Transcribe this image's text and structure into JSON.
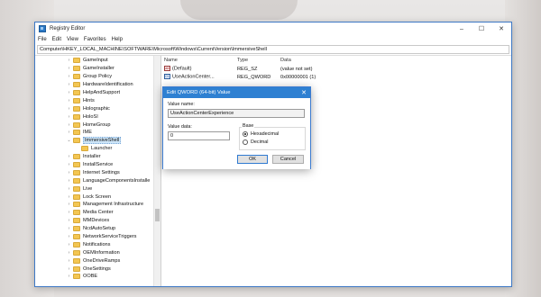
{
  "window": {
    "title": "Registry Editor",
    "controls": {
      "minimize": "–",
      "maximize": "☐",
      "close": "✕"
    }
  },
  "menu": [
    "File",
    "Edit",
    "View",
    "Favorites",
    "Help"
  ],
  "address": "Computer\\HKEY_LOCAL_MACHINE\\SOFTWARE\\Microsoft\\Windows\\CurrentVersion\\ImmersiveShell",
  "tree": [
    {
      "label": "GameInput",
      "expander": "›"
    },
    {
      "label": "GameInstaller",
      "expander": "›"
    },
    {
      "label": "Group Policy",
      "expander": "›"
    },
    {
      "label": "HardwareIdentification",
      "expander": "›"
    },
    {
      "label": "HelpAndSupport",
      "expander": "›"
    },
    {
      "label": "Hints",
      "expander": "›"
    },
    {
      "label": "Holographic",
      "expander": "›"
    },
    {
      "label": "HoloSI",
      "expander": "›"
    },
    {
      "label": "HomeGroup",
      "expander": "›"
    },
    {
      "label": "IME",
      "expander": "›"
    },
    {
      "label": "ImmersiveShell",
      "expander": "⌄",
      "selected": true
    },
    {
      "label": "Launcher",
      "expander": "",
      "child": true
    },
    {
      "label": "Installer",
      "expander": "›"
    },
    {
      "label": "InstallService",
      "expander": "›"
    },
    {
      "label": "Internet Settings",
      "expander": "›"
    },
    {
      "label": "LanguageComponentsInstalle",
      "expander": "›"
    },
    {
      "label": "Live",
      "expander": "›"
    },
    {
      "label": "Lock Screen",
      "expander": "›"
    },
    {
      "label": "Management Infrastructure",
      "expander": "›"
    },
    {
      "label": "Media Center",
      "expander": "›"
    },
    {
      "label": "MMDevices",
      "expander": "›"
    },
    {
      "label": "NcdAutoSetup",
      "expander": "›"
    },
    {
      "label": "NetworkServiceTriggers",
      "expander": "›"
    },
    {
      "label": "Notifications",
      "expander": "›"
    },
    {
      "label": "OEMInformation",
      "expander": "›"
    },
    {
      "label": "OneDriveRamps",
      "expander": "›"
    },
    {
      "label": "OneSettings",
      "expander": "›"
    },
    {
      "label": "OOBE",
      "expander": "›"
    }
  ],
  "columns": {
    "name": "Name",
    "type": "Type",
    "data": "Data"
  },
  "values": [
    {
      "icon": "ab",
      "name": "(Default)",
      "type": "REG_SZ",
      "data": "(value not set)"
    },
    {
      "icon": "01",
      "name": "UseActionCenter...",
      "type": "REG_QWORD",
      "data": "0x00000001 (1)"
    }
  ],
  "dialog": {
    "title": "Edit QWORD (64-bit) Value",
    "close": "✕",
    "value_name_label": "Value name:",
    "value_name": "UseActionCenterExperience",
    "value_data_label": "Value data:",
    "value_data": "0",
    "base_label": "Base",
    "hex_label": "Hexadecimal",
    "dec_label": "Decimal",
    "selected_base": "Hexadecimal",
    "ok_label": "OK",
    "cancel_label": "Cancel"
  }
}
